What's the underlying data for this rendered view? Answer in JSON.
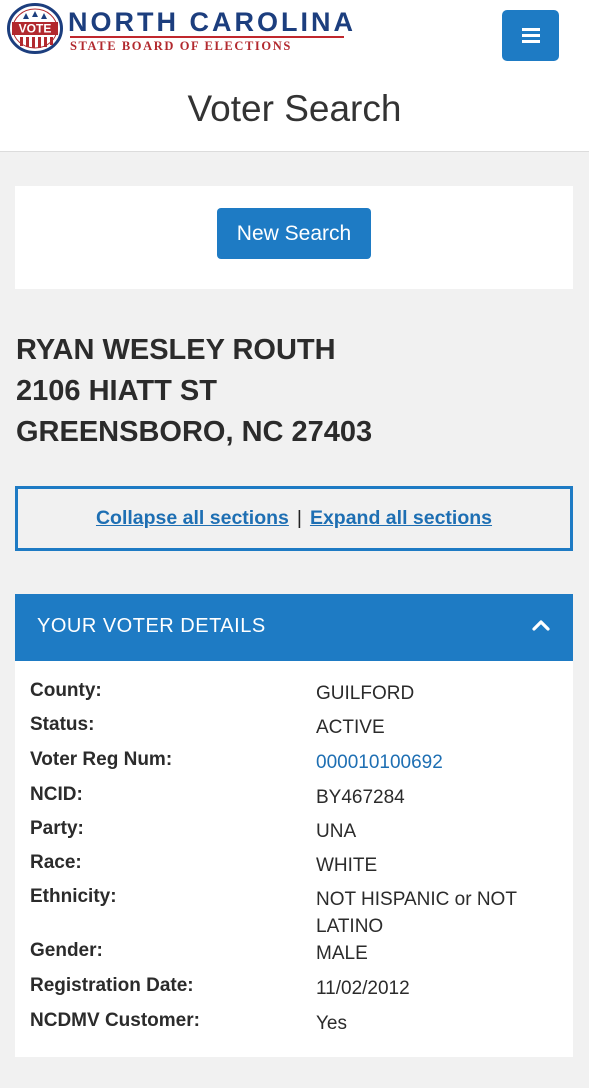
{
  "header": {
    "logo_seal_text": "VOTE",
    "logo_title": "NORTH CAROLINA",
    "logo_subtitle": "STATE BOARD OF ELECTIONS",
    "menu_icon": "hamburger-menu-icon",
    "page_title": "Voter Search"
  },
  "search": {
    "new_search_label": "New Search"
  },
  "voter": {
    "name": "RYAN WESLEY ROUTH",
    "street": "2106 HIATT ST",
    "city_state_zip": "GREENSBORO, NC 27403"
  },
  "section_controls": {
    "collapse_label": "Collapse all sections",
    "separator": "|",
    "expand_label": "Expand all sections"
  },
  "details": {
    "title": "YOUR VOTER DETAILS",
    "toggle_icon": "chevron-up-icon",
    "rows": [
      {
        "label": "County:",
        "value": "GUILFORD"
      },
      {
        "label": "Status:",
        "value": "ACTIVE"
      },
      {
        "label": "Voter Reg Num:",
        "value": "000010100692"
      },
      {
        "label": "NCID:",
        "value": "BY467284"
      },
      {
        "label": "Party:",
        "value": "UNA"
      },
      {
        "label": "Race:",
        "value": "WHITE"
      },
      {
        "label": "Ethnicity:",
        "value": "NOT HISPANIC or NOT LATINO"
      },
      {
        "label": "Gender:",
        "value": "MALE"
      },
      {
        "label": "Registration Date:",
        "value": "11/02/2012"
      },
      {
        "label": "NCDMV Customer:",
        "value": "Yes"
      }
    ]
  },
  "colors": {
    "primary_blue": "#1e7bc4",
    "link_blue": "#1e6fb3",
    "logo_navy": "#1c3e7e",
    "logo_red": "#b2292e",
    "page_bg": "#f1f1f1"
  }
}
